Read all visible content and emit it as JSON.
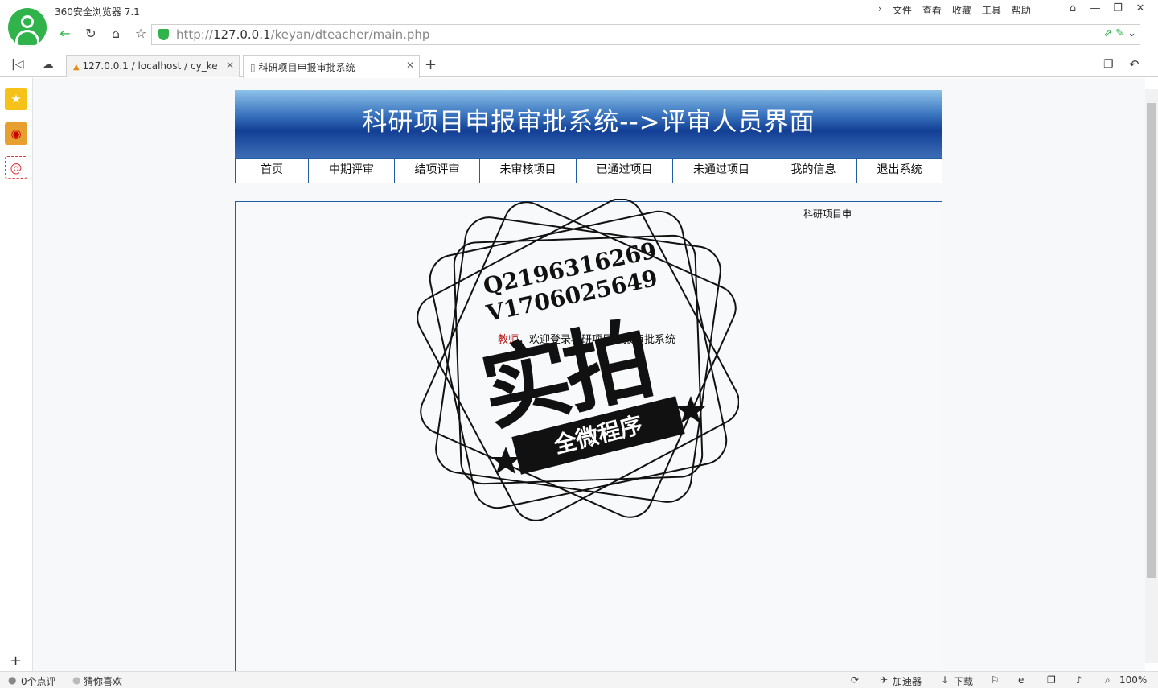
{
  "browser": {
    "app_title": "360安全浏览器 7.1",
    "menu": [
      "文件",
      "查看",
      "收藏",
      "工具",
      "帮助"
    ],
    "url_prefix": "http://",
    "url_host": "127.0.0.1",
    "url_path": "/keyan/dteacher/main.php",
    "tabs": [
      {
        "label": "127.0.0.1 / localhost / cy_ke"
      },
      {
        "label": "科研项目申报审批系统"
      }
    ]
  },
  "page": {
    "banner_title": "科研项目申报审批系统-->评审人员界面",
    "nav": [
      "首页",
      "中期评审",
      "结项评审",
      "未审核项目",
      "已通过项目",
      "未通过项目",
      "我的信息",
      "退出系统"
    ],
    "marquee": "科研项目申",
    "welcome_prefix": "教师",
    "welcome_text": "，欢迎登录科研项目申报审批系统"
  },
  "watermark": {
    "line1": "Q2196316269",
    "line2": "V1706025649",
    "big": "实拍",
    "ribbon": "全微程序"
  },
  "statusbar": {
    "left1": "0个点评",
    "left2": "猜你喜欢",
    "accelerator": "加速器",
    "download": "下载",
    "zoom": "100%"
  },
  "colors": {
    "banner_dark": "#123f95",
    "nav_border": "#1f5ea6",
    "brand_green": "#2fb34a"
  }
}
